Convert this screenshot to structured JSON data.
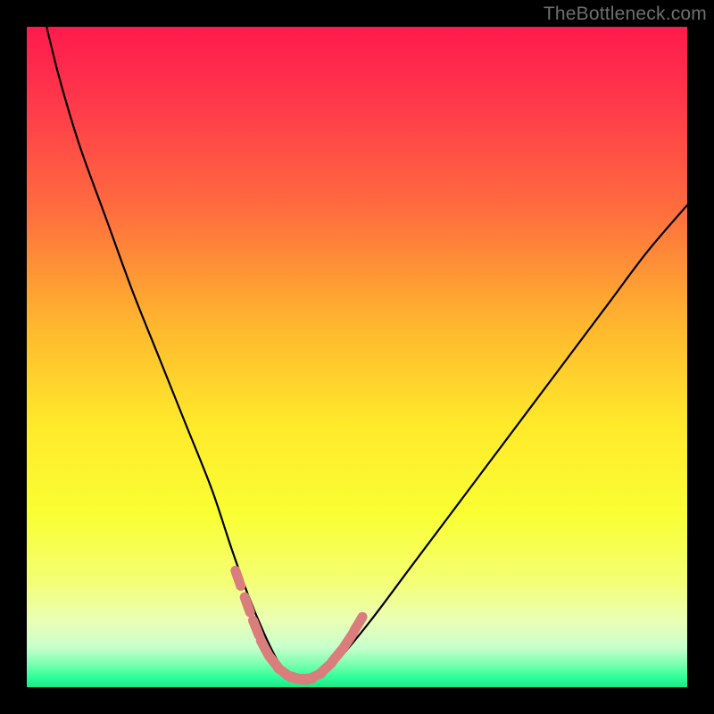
{
  "watermark": "TheBottleneck.com",
  "colors": {
    "frame": "#000000",
    "watermark": "#6f6f6f",
    "curve": "#000000",
    "marker": "#d97d7d",
    "gradient_stops": [
      {
        "offset": 0.0,
        "color": "#ff1a4d"
      },
      {
        "offset": 0.12,
        "color": "#ff3a4a"
      },
      {
        "offset": 0.28,
        "color": "#ff6e3e"
      },
      {
        "offset": 0.45,
        "color": "#ffb62e"
      },
      {
        "offset": 0.6,
        "color": "#ffe92a"
      },
      {
        "offset": 0.74,
        "color": "#f9ff33"
      },
      {
        "offset": 0.84,
        "color": "#f4ff75"
      },
      {
        "offset": 0.9,
        "color": "#e9ffb6"
      },
      {
        "offset": 0.94,
        "color": "#c7ffcc"
      },
      {
        "offset": 0.965,
        "color": "#7bffb0"
      },
      {
        "offset": 0.985,
        "color": "#2dff9a"
      },
      {
        "offset": 1.0,
        "color": "#19e888"
      }
    ]
  },
  "chart_data": {
    "type": "line",
    "title": "",
    "xlabel": "",
    "ylabel": "",
    "xlim": [
      0,
      100
    ],
    "ylim": [
      0,
      100
    ],
    "series": [
      {
        "name": "bottleneck-curve",
        "x": [
          3,
          5,
          8,
          12,
          16,
          20,
          24,
          28,
          31,
          33.5,
          36,
          38,
          40,
          42,
          44,
          47,
          52,
          58,
          64,
          70,
          76,
          82,
          88,
          94,
          100
        ],
        "y": [
          100,
          92,
          82,
          71,
          60,
          50,
          40,
          30,
          21,
          14,
          8,
          4,
          1.5,
          1.2,
          1.5,
          4,
          10,
          18,
          26,
          34,
          42,
          50,
          58,
          66,
          73
        ]
      }
    ],
    "markers": [
      {
        "x": 32.0,
        "y": 16.5
      },
      {
        "x": 33.4,
        "y": 12.5
      },
      {
        "x": 34.7,
        "y": 9.0
      },
      {
        "x": 36.0,
        "y": 6.0
      },
      {
        "x": 37.5,
        "y": 3.7
      },
      {
        "x": 39.0,
        "y": 2.2
      },
      {
        "x": 40.5,
        "y": 1.5
      },
      {
        "x": 42.0,
        "y": 1.3
      },
      {
        "x": 43.5,
        "y": 1.6
      },
      {
        "x": 45.2,
        "y": 2.8
      },
      {
        "x": 47.0,
        "y": 4.8
      },
      {
        "x": 48.7,
        "y": 7.1
      },
      {
        "x": 50.2,
        "y": 9.6
      }
    ]
  }
}
